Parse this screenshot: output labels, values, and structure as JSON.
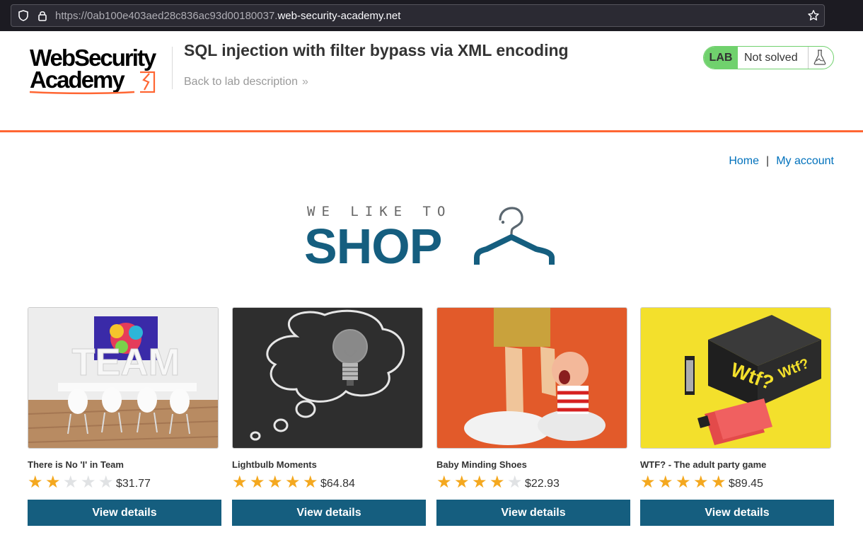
{
  "browser": {
    "url_prefix": "https://0ab100e403aed28c836ac93d00180037.",
    "url_host": "web-security-academy.net"
  },
  "header": {
    "logo_line1": "WebSecurity",
    "logo_line2": "Academy",
    "lab_title": "SQL injection with filter bypass via XML encoding",
    "back_link": "Back to lab description",
    "lab_badge": "LAB",
    "lab_status": "Not solved"
  },
  "nav": {
    "home": "Home",
    "separator": "|",
    "my_account": "My account"
  },
  "banner": {
    "tagline": "WE LIKE TO",
    "title": "SHOP"
  },
  "products": [
    {
      "name": "There is No 'I' in Team",
      "rating": 2,
      "price": "$31.77",
      "button": "View details"
    },
    {
      "name": "Lightbulb Moments",
      "rating": 5,
      "price": "$64.84",
      "button": "View details"
    },
    {
      "name": "Baby Minding Shoes",
      "rating": 4,
      "price": "$22.93",
      "button": "View details"
    },
    {
      "name": "WTF? - The adult party game",
      "rating": 5,
      "price": "$89.45",
      "button": "View details"
    }
  ],
  "product_images": [
    {
      "texts": [
        "TEAM"
      ]
    },
    {
      "texts": []
    },
    {
      "texts": []
    },
    {
      "texts": [
        "Wtf?",
        "Wtf?"
      ]
    }
  ],
  "colors": {
    "accent_orange": "#ff6633",
    "button_blue": "#155e7f",
    "link_blue": "#0071bc",
    "lab_green": "#70d16d",
    "star_gold": "#f4a81f"
  }
}
